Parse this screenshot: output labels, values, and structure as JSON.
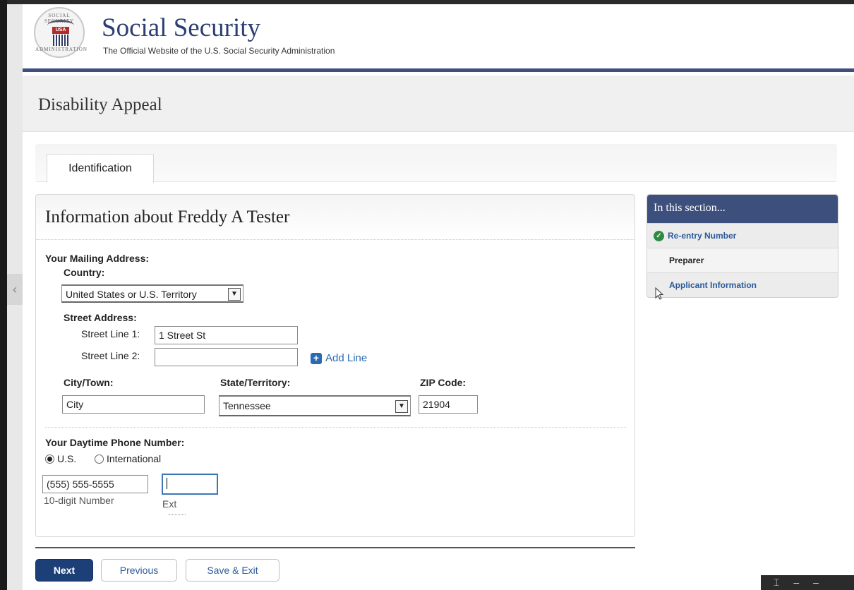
{
  "header": {
    "seal_top_text": "SOCIAL SECURITY",
    "seal_badge": "USA",
    "seal_bottom_text": "ADMINISTRATION",
    "title": "Social Security",
    "subtitle": "The Official Website of the U.S. Social Security Administration"
  },
  "page": {
    "title": "Disability Appeal"
  },
  "tabs": [
    {
      "label": "Identification"
    }
  ],
  "form": {
    "heading": "Information about Freddy A Tester",
    "mailing_label": "Your Mailing Address:",
    "country_label": "Country:",
    "country_value": "United States or U.S. Territory",
    "street_label": "Street Address:",
    "street1_label": "Street Line 1:",
    "street1_value": "1 Street St",
    "street2_label": "Street Line 2:",
    "street2_value": "",
    "add_line": "Add Line",
    "city_label": "City/Town:",
    "city_value": "City",
    "state_label": "State/Territory:",
    "state_value": "Tennessee",
    "zip_label": "ZIP Code:",
    "zip_value": "21904",
    "phone_label": "Your Daytime Phone Number:",
    "radio_us": "U.S.",
    "radio_intl": "International",
    "phone_value": "(555) 555-5555",
    "phone_help": "10-digit Number",
    "ext_value": "",
    "ext_help": "Ext"
  },
  "nav": {
    "next": "Next",
    "previous": "Previous",
    "save_exit": "Save & Exit"
  },
  "sidebar": {
    "heading": "In this section...",
    "items": [
      {
        "label": "Re-entry Number",
        "status": "complete"
      },
      {
        "label": "Preparer",
        "status": "current"
      },
      {
        "label": "Applicant Information",
        "status": "link"
      }
    ]
  },
  "colors": {
    "brand_navy": "#3d4f7c",
    "button_navy": "#1d3f78",
    "link_blue": "#2a6ab2",
    "check_green": "#2e8b3e"
  }
}
